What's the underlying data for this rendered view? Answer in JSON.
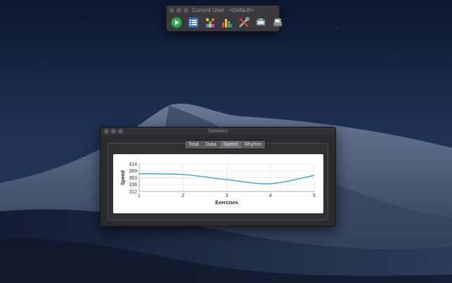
{
  "toolbar": {
    "title": "Current User - <Default>",
    "buttons": [
      {
        "name": "play",
        "icon": "play-icon"
      },
      {
        "name": "list",
        "icon": "list-icon"
      },
      {
        "name": "users",
        "icon": "users-icon"
      },
      {
        "name": "bar-chart",
        "icon": "bar-chart-icon"
      },
      {
        "name": "tools",
        "icon": "tools-icon"
      },
      {
        "name": "network",
        "icon": "network-icon"
      },
      {
        "name": "print",
        "icon": "printer-icon"
      }
    ]
  },
  "statistics": {
    "title": "Statistics",
    "tabs": [
      "Total",
      "Data",
      "Speed",
      "Rhythm"
    ],
    "active_tab": "Speed"
  },
  "chart_data": {
    "type": "line",
    "x": [
      1,
      2,
      3,
      4,
      5
    ],
    "y": [
      378,
      375,
      356,
      341,
      372
    ],
    "yticks": [
      414,
      389,
      363,
      338,
      312
    ],
    "ylim": [
      312,
      414
    ],
    "xlim": [
      1,
      5
    ],
    "xlabel": "Exercises",
    "ylabel": "Speed",
    "grid": true,
    "line_color": "#2a9fd8"
  }
}
